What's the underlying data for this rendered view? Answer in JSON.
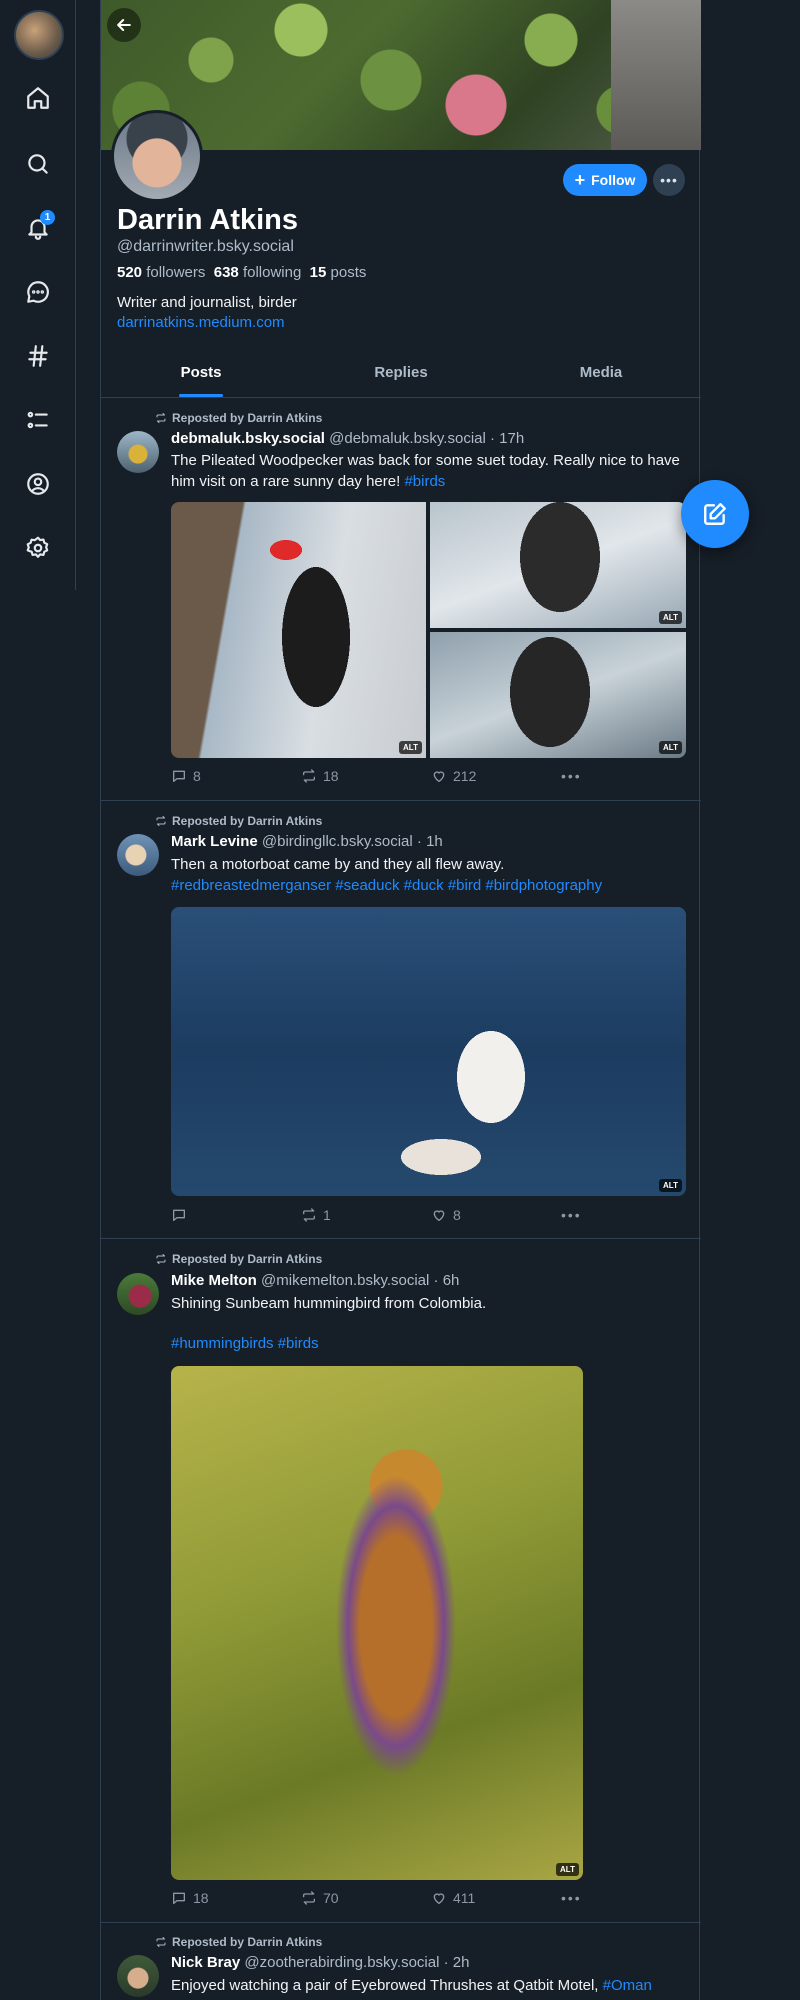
{
  "nav": {
    "notifications_badge": "1"
  },
  "profile": {
    "display_name": "Darrin Atkins",
    "handle": "@darrinwriter.bsky.social",
    "followers_count": "520",
    "followers_label": "followers",
    "following_count": "638",
    "following_label": "following",
    "posts_count": "15",
    "posts_label": "posts",
    "bio": "Writer and journalist, birder",
    "link": "darrinatkins.medium.com",
    "follow_label": "Follow"
  },
  "tabs": [
    {
      "label": "Posts",
      "active": true
    },
    {
      "label": "Replies",
      "active": false
    },
    {
      "label": "Media",
      "active": false
    }
  ],
  "posts": [
    {
      "repost_label": "Reposted by Darrin Atkins",
      "author_name": "debmaluk.bsky.social",
      "author_handle": "@debmaluk.bsky.social",
      "time": "· 17h",
      "text": "The Pileated Woodpecker was back for some suet today.  Really nice to have him visit on a rare sunny day here!",
      "tags": "#birds",
      "alt": "ALT",
      "replies": "8",
      "reposts": "18",
      "likes": "212"
    },
    {
      "repost_label": "Reposted by Darrin Atkins",
      "author_name": "Mark Levine",
      "author_handle": "@birdingllc.bsky.social",
      "time": "· 1h",
      "text": "Then a motorboat came by and they all flew away.",
      "tags": "#redbreastedmerganser #seaduck #duck #bird #birdphotography",
      "alt": "ALT",
      "replies": "",
      "reposts": "1",
      "likes": "8"
    },
    {
      "repost_label": "Reposted by Darrin Atkins",
      "author_name": "Mike Melton",
      "author_handle": "@mikemelton.bsky.social",
      "time": "· 6h",
      "text": "Shining Sunbeam hummingbird from Colombia.",
      "tags": "#hummingbirds #birds",
      "alt": "ALT",
      "replies": "18",
      "reposts": "70",
      "likes": "411"
    },
    {
      "repost_label": "Reposted by Darrin Atkins",
      "author_name": "Nick Bray",
      "author_handle": "@zootherabirding.bsky.social",
      "time": "· 2h",
      "text": "Enjoyed watching a pair of Eyebrowed Thrushes at Qatbit Motel,",
      "tags": "#Oman"
    }
  ]
}
